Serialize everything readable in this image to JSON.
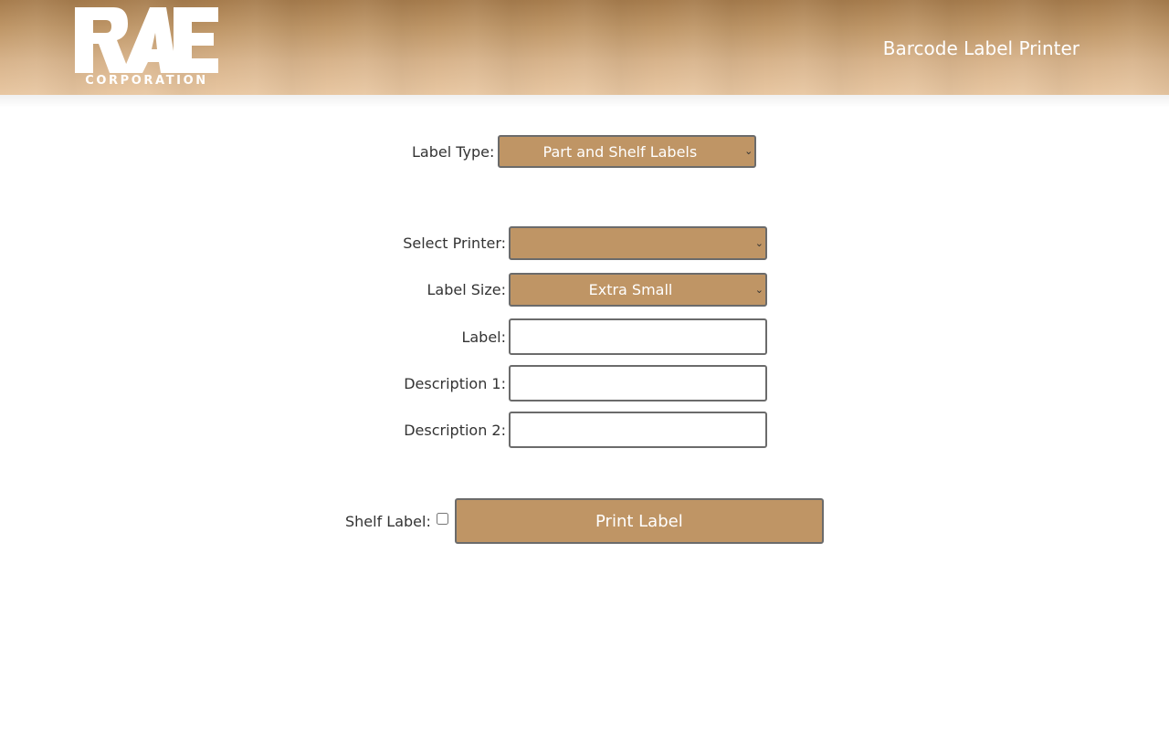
{
  "header": {
    "logo_text": "CORPORATION",
    "logo_letters": "RAE",
    "title": "Barcode Label Printer"
  },
  "form": {
    "label_type": {
      "label": "Label Type:",
      "value": "Part and Shelf Labels"
    },
    "select_printer": {
      "label": "Select Printer:",
      "value": ""
    },
    "label_size": {
      "label": "Label Size:",
      "value": "Extra Small"
    },
    "label": {
      "label": "Label:",
      "value": ""
    },
    "description1": {
      "label": "Description 1:",
      "value": ""
    },
    "description2": {
      "label": "Description 2:",
      "value": ""
    },
    "shelf_label": {
      "label": "Shelf Label:",
      "checked": false
    },
    "print_button": "Print Label"
  },
  "colors": {
    "accent": "#bf9565",
    "border": "#6b6b6b",
    "header_top": "#a67c4d",
    "header_bottom": "#e8c7a2"
  }
}
